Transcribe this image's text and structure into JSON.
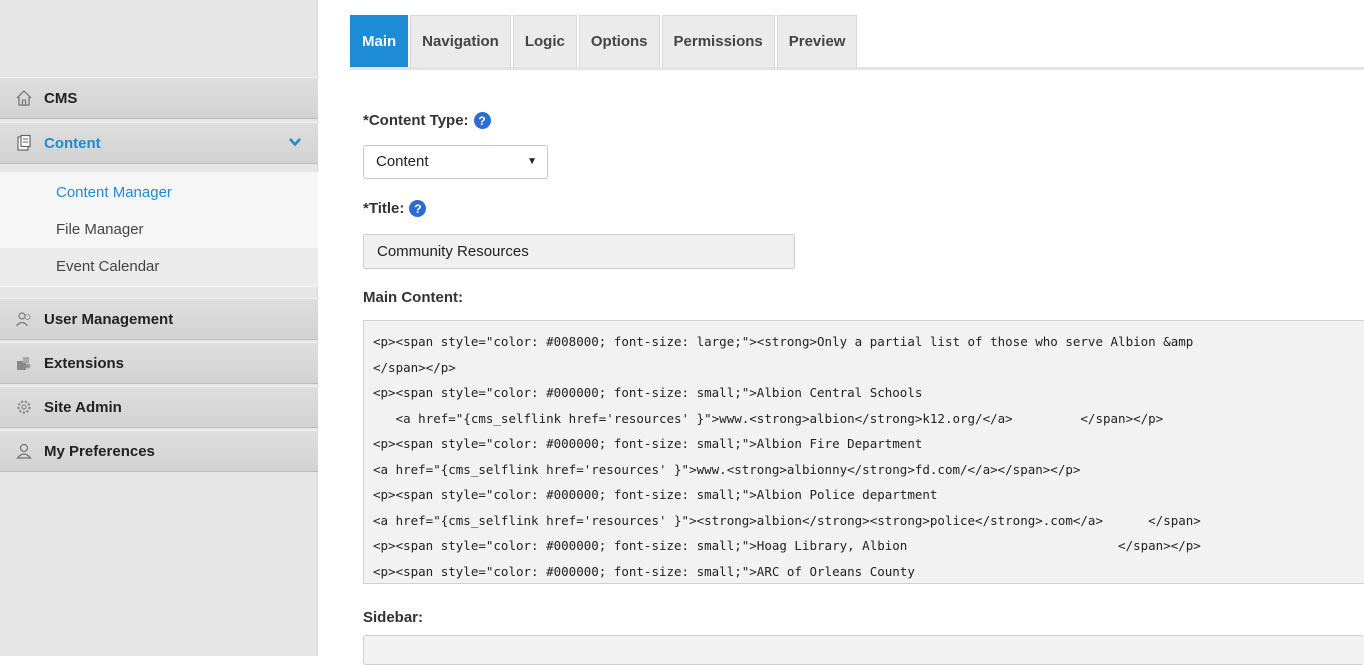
{
  "nav": {
    "items": [
      {
        "label": "CMS",
        "icon": "home-icon"
      },
      {
        "label": "Content",
        "icon": "document-icon",
        "active": true
      },
      {
        "label": "User Management",
        "icon": "users-icon"
      },
      {
        "label": "Extensions",
        "icon": "puzzle-icon"
      },
      {
        "label": "Site Admin",
        "icon": "gear-icon"
      },
      {
        "label": "My Preferences",
        "icon": "user-icon"
      }
    ],
    "submenu": [
      {
        "label": "Content Manager"
      },
      {
        "label": "File Manager"
      },
      {
        "label": "Event Calendar"
      }
    ],
    "accent_color": "#1d8bd6"
  },
  "tabs": [
    {
      "label": "Main"
    },
    {
      "label": "Navigation"
    },
    {
      "label": "Logic"
    },
    {
      "label": "Options"
    },
    {
      "label": "Permissions"
    },
    {
      "label": "Preview"
    }
  ],
  "form": {
    "content_type_label": "*Content Type:",
    "content_type_value": "Content",
    "title_label": "*Title:",
    "title_value": "Community Resources",
    "main_content_label": "Main Content:",
    "sidebar_label": "Sidebar:",
    "help_glyph": "?"
  },
  "code_lines": [
    "<p><span style=\"color: #008000; font-size: large;\"><strong>Only a partial list of those who serve Albion &amp",
    "</span></p>",
    "<p><span style=\"color: #000000; font-size: small;\">Albion Central Schools",
    "   <a href=\"{cms_selflink href='resources' }\">www.<strong>albion</strong>k12.org/</a>         </span></p>",
    "<p><span style=\"color: #000000; font-size: small;\">Albion Fire Department",
    "<a href=\"{cms_selflink href='resources' }\">www.<strong>albionny</strong>fd.com/</a></span></p>",
    "<p><span style=\"color: #000000; font-size: small;\">Albion Police department",
    "<a href=\"{cms_selflink href='resources' }\"><strong>albion</strong><strong>police</strong>.com</a>      </span>",
    "<p><span style=\"color: #000000; font-size: small;\">Hoag Library, Albion                            </span></p>",
    "<p><span style=\"color: #000000; font-size: small;\">ARC of Orleans County"
  ]
}
